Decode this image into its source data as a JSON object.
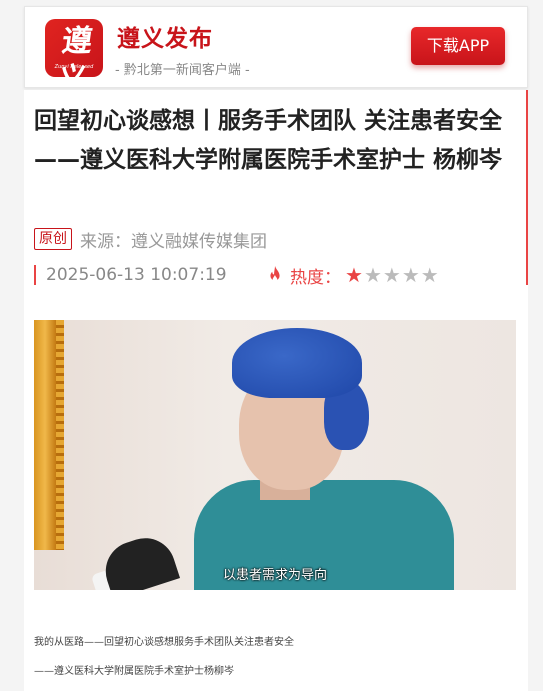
{
  "header": {
    "logo_text": "遵义",
    "logo_subtext": "Zunyi Released",
    "brand_name": "遵义发布",
    "tagline": "- 黔北第一新闻客户端 -",
    "download_label": "下载APP"
  },
  "article": {
    "title": "回望初心谈感想丨服务手术团队 关注患者安全——遵义医科大学附属医院手术室护士 杨柳岑",
    "badge": "原创",
    "source_label": "来源：",
    "source_value": "遵义融媒传媒集团",
    "datetime": "2025-06-13 10:07:19",
    "heat_label": "热度：",
    "rating": 0.5,
    "rating_max": 5,
    "video_caption": "以患者需求为导向",
    "body_lines": [
      "我的从医路——回望初心谈感想服务手术团队关注患者安全",
      "——遵义医科大学附属医院手术室护士杨柳岑"
    ]
  },
  "colors": {
    "brand_red": "#c8141a",
    "accent_red": "#e94444",
    "muted_text": "#999999"
  }
}
